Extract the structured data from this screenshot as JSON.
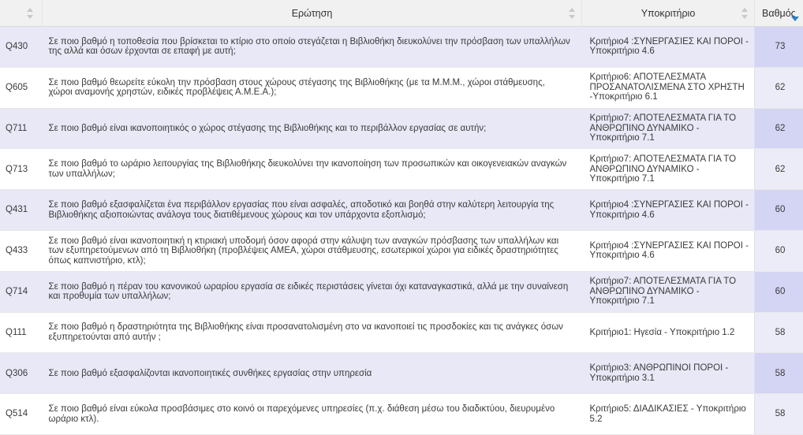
{
  "headers": {
    "question": "Ερώτηση",
    "criterion": "Υποκριτήριο",
    "score": "Βαθμός"
  },
  "rows": [
    {
      "code": "Q430",
      "question": "Σε ποιο βαθμό η τοποθεσία που βρίσκεται το κτίριο στο οποίο στεγάζεται η Βιβλιοθήκη διευκολύνει την πρόσβαση των υπαλλήλων της αλλά και όσων έρχονται σε επαφή με αυτή;",
      "criterion": "Κριτήριο4 :ΣΥΝΕΡΓΑΣΙΕΣ ΚΑΙ ΠΟΡΟΙ - Υποκριτήριο 4.6",
      "score": "73"
    },
    {
      "code": "Q605",
      "question": "Σε ποιο βαθμό θεωρείτε εύκολη την πρόσβαση στους χώρους στέγασης της Βιβλιοθήκης (με τα Μ.Μ.Μ., χώροι στάθμευσης, χώροι αναμονής χρηστών, ειδικές προβλέψεις Α.Μ.Ε.Α.);",
      "criterion": "Κριτήριο6: ΑΠΟΤΕΛΕΣΜΑΤΑ ΠΡΟΣΑΝΑΤΟΛΙΣΜΕΝΑ ΣΤΟ ΧΡΗΣΤΗ -Υποκριτήριο 6.1",
      "score": "62"
    },
    {
      "code": "Q711",
      "question": "Σε ποιο βαθμό είναι ικανοποιητικός ο χώρος στέγασης της Βιβλιοθήκης και το περιβάλλον εργασίας σε αυτήν;",
      "criterion": "Κριτήριο7: ΑΠΟΤΕΛΕΣΜΑΤΑ ΓΙΑ ΤΟ ΑΝΘΡΩΠΙΝΟ ΔΥΝΑΜΙΚΟ - Υποκριτήριο 7.1",
      "score": "62"
    },
    {
      "code": "Q713",
      "question": "Σε ποιο βαθμό το ωράριο λειτουργίας της Βιβλιοθήκης διευκολύνει την ικανοποίηση των προσωπικών και οικογενειακών αναγκών των υπαλλήλων;",
      "criterion": "Κριτήριο7: ΑΠΟΤΕΛΕΣΜΑΤΑ ΓΙΑ ΤΟ ΑΝΘΡΩΠΙΝΟ ΔΥΝΑΜΙΚΟ - Υποκριτήριο 7.1",
      "score": "62"
    },
    {
      "code": "Q431",
      "question": "Σε ποιο βαθμό εξασφαλίζεται ένα περιβάλλον εργασίας που είναι ασφαλές, αποδοτικό και βοηθά στην καλύτερη λειτουργία της Βιβλιοθήκης αξιοποιώντας ανάλογα τους διατιθέμενους χώρους και τον υπάρχοντα εξοπλισμό;",
      "criterion": "Κριτήριο4 :ΣΥΝΕΡΓΑΣΙΕΣ ΚΑΙ ΠΟΡΟΙ - Υποκριτήριο 4.6",
      "score": "60"
    },
    {
      "code": "Q433",
      "question": "Σε ποιο βαθμό είναι ικανοποιητική η κτιριακή υποδομή όσον αφορά στην κάλυψη των αναγκών πρόσβασης των υπαλλήλων και των εξυπηρετούμενων από τη Βιβλιοθήκη (προβλέψεις ΑΜΕΑ, χώροι στάθμευσης, εσωτερικοί χώροι για ειδικές δραστηριότητες όπως καπνιστήριο, κτλ);",
      "criterion": "Κριτήριο4 :ΣΥΝΕΡΓΑΣΙΕΣ ΚΑΙ ΠΟΡΟΙ - Υποκριτήριο 4.6",
      "score": "60"
    },
    {
      "code": "Q714",
      "question": "Σε ποιο βαθμό η πέραν του κανονικού ωραρίου εργασία σε ειδικές περιστάσεις γίνεται όχι καταναγκαστικά, αλλά με την συναίνεση και προθυμία των υπαλλήλων;",
      "criterion": "Κριτήριο7: ΑΠΟΤΕΛΕΣΜΑΤΑ ΓΙΑ ΤΟ ΑΝΘΡΩΠΙΝΟ ΔΥΝΑΜΙΚΟ - Υποκριτήριο 7.1",
      "score": "60"
    },
    {
      "code": "Q111",
      "question": "Σε ποιο βαθμό η δραστηριότητα της Βιβλιοθήκης είναι προσανατολισμένη στο να ικανοποιεί τις προσδοκίες και τις ανάγκες όσων εξυπηρετούνται από αυτήν ;",
      "criterion": "Κριτήριο1: Ηγεσία - Υποκριτήριο 1.2",
      "score": "58"
    },
    {
      "code": "Q306",
      "question": "Σε ποιο βαθμό εξασφαλίζονται ικανοποιητικές συνθήκες εργασίας στην υπηρεσία",
      "criterion": "Κριτήριο3: ΑΝΘΡΩΠΙΝΟΙ ΠΟΡΟΙ - Υποκριτήριο 3.1",
      "score": "58"
    },
    {
      "code": "Q514",
      "question": "Σε ποιο βαθμό είναι εύκολα προσβάσιμες στο κοινό οι παρεχόμενες υπηρεσίες (π.χ. διάθεση μέσω του διαδικτύου, διευρυμένο ωράριο κτλ).",
      "criterion": "Κριτήριο5: ΔΙΑΔΙΚΑΣΙΕΣ - Υποκριτήριο 5.2",
      "score": "58"
    }
  ]
}
